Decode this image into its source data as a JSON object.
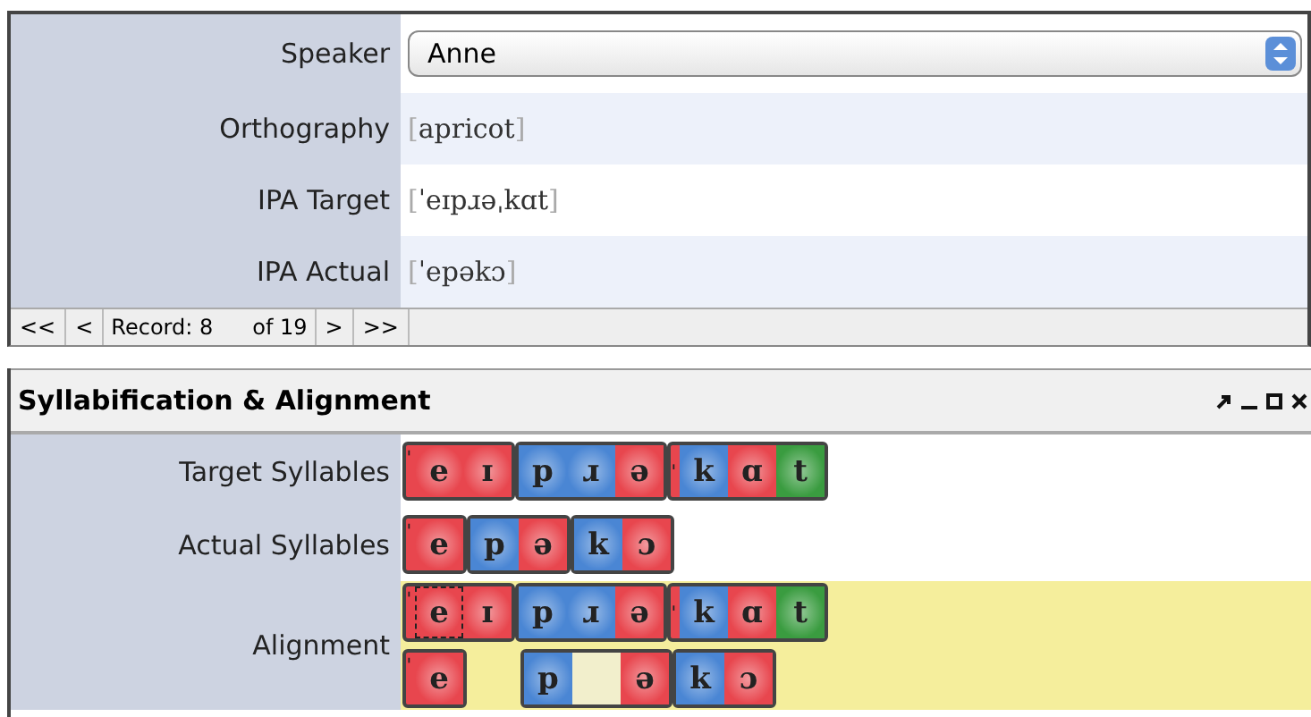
{
  "record_panel": {
    "fields": [
      {
        "kind": "select",
        "label": "Speaker",
        "value": "Anne"
      },
      {
        "kind": "text",
        "label": "Orthography",
        "open": "[",
        "value": "apricot",
        "close": "]"
      },
      {
        "kind": "text",
        "label": "IPA Target",
        "open": "[",
        "value": "ˈeɪpɹəˌkɑt",
        "close": "]"
      },
      {
        "kind": "text",
        "label": "IPA Actual",
        "open": "[",
        "value": "ˈepəkɔ",
        "close": "]"
      }
    ],
    "navigation": {
      "first": "<<",
      "previous": "<",
      "record_label": "Record: 8",
      "total": "of 19",
      "next": ">",
      "last": ">>"
    }
  },
  "syllable_panel": {
    "title": "Syllabification & Alignment",
    "target_label": "Target Syllables",
    "target": [
      {
        "stress": "ˈ",
        "phones": [
          {
            "kind": "phone",
            "text": "e",
            "color": "#e8464e",
            "selected": false
          },
          {
            "kind": "phone",
            "text": "ɪ",
            "color": "#e8464e",
            "selected": false
          }
        ]
      },
      {
        "phones": [
          {
            "kind": "phone",
            "text": "p",
            "color": "#4a86d4",
            "selected": false
          },
          {
            "kind": "phone",
            "text": "ɹ",
            "color": "#4a86d4",
            "selected": false
          },
          {
            "kind": "phone",
            "text": "ə",
            "color": "#e8464e",
            "selected": false
          }
        ]
      },
      {
        "stress": "ˌ",
        "phones": [
          {
            "kind": "phone",
            "text": "k",
            "color": "#4a86d4",
            "selected": false
          },
          {
            "kind": "phone",
            "text": "ɑ",
            "color": "#e8464e",
            "selected": false
          },
          {
            "kind": "phone",
            "text": "t",
            "color": "#3a9c40",
            "selected": false
          }
        ]
      }
    ],
    "actual_label": "Actual Syllables",
    "actual": [
      {
        "stress": "ˈ",
        "phones": [
          {
            "kind": "phone",
            "text": "e",
            "color": "#e8464e",
            "selected": false
          }
        ]
      },
      {
        "phones": [
          {
            "kind": "phone",
            "text": "p",
            "color": "#4a86d4",
            "selected": false
          },
          {
            "kind": "phone",
            "text": "ə",
            "color": "#e8464e",
            "selected": false
          }
        ]
      },
      {
        "phones": [
          {
            "kind": "phone",
            "text": "k",
            "color": "#4a86d4",
            "selected": false
          },
          {
            "kind": "phone",
            "text": "ɔ",
            "color": "#e8464e",
            "selected": false
          }
        ]
      }
    ],
    "alignment_label": "Alignment",
    "alignment": [
      [
        {
          "kind": "syllable",
          "stress": "ˈ",
          "phones": [
            {
              "kind": "phone",
              "text": "e",
              "color": "#e8464e",
              "selected": true
            },
            {
              "kind": "phone",
              "text": "ɪ",
              "color": "#e8464e",
              "selected": false
            }
          ]
        },
        {
          "kind": "syllable",
          "phones": [
            {
              "kind": "phone",
              "text": "p",
              "color": "#4a86d4",
              "selected": false
            },
            {
              "kind": "phone",
              "text": "ɹ",
              "color": "#4a86d4",
              "selected": false
            },
            {
              "kind": "phone",
              "text": "ə",
              "color": "#e8464e",
              "selected": false
            }
          ]
        },
        {
          "kind": "syllable",
          "stress": "ˌ",
          "phones": [
            {
              "kind": "phone",
              "text": "k",
              "color": "#4a86d4",
              "selected": false
            },
            {
              "kind": "phone",
              "text": "ɑ",
              "color": "#e8464e",
              "selected": false
            },
            {
              "kind": "phone",
              "text": "t",
              "color": "#3a9c40",
              "selected": false
            }
          ]
        }
      ],
      [
        {
          "kind": "syllable",
          "stress": "ˈ",
          "phones": [
            {
              "kind": "phone",
              "text": "e",
              "color": "#e8464e",
              "selected": false
            }
          ]
        },
        {
          "kind": "space"
        },
        {
          "kind": "syllable",
          "phones": [
            {
              "kind": "phone",
              "text": "p",
              "color": "#4a86d4",
              "selected": false
            },
            {
              "kind": "gap"
            },
            {
              "kind": "phone",
              "text": "ə",
              "color": "#e8464e",
              "selected": false
            }
          ]
        },
        {
          "kind": "syllable",
          "phones": [
            {
              "kind": "phone",
              "text": "k",
              "color": "#4a86d4",
              "selected": false
            },
            {
              "kind": "phone",
              "text": "ɔ",
              "color": "#e8464e",
              "selected": false
            }
          ]
        }
      ]
    ]
  }
}
